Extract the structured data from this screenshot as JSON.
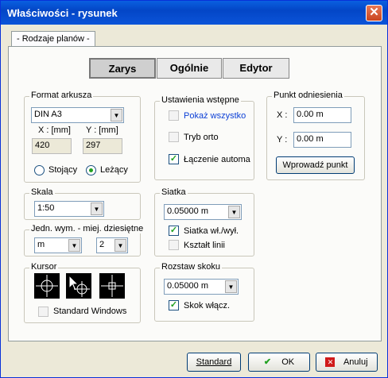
{
  "window": {
    "title": "Właściwości - rysunek",
    "close_glyph": "✕"
  },
  "tab": {
    "label": "- Rodzaje planów -"
  },
  "mode_buttons": [
    "Zarys",
    "Ogólnie",
    "Edytor"
  ],
  "format": {
    "label": "Format arkusza",
    "sheet_value": "DIN A3",
    "x_label": "X : [mm]",
    "y_label": "Y : [mm]",
    "x_value": "420",
    "y_value": "297",
    "portrait_label": "Stojący",
    "landscape_label": "Leżący",
    "orientation_selected": "Leżący"
  },
  "scale": {
    "label": "Skala",
    "value": "1:50"
  },
  "units": {
    "label": "Jedn. wym. - miej. dziesiętne",
    "unit_value": "m",
    "decimals_value": "2"
  },
  "cursor": {
    "label": "Kursor",
    "options": [
      "crosshair-circle-icon",
      "arrow-crosshair-icon",
      "crosshair-icon"
    ],
    "standard_windows_label": "Standard Windows",
    "standard_windows_checked": false
  },
  "presets": {
    "label": "Ustawienia wstępne",
    "show_all_label": "Pokaż wszystko",
    "show_all_checked": false,
    "ortho_label": "Tryb orto",
    "ortho_checked": false,
    "connect_label": "Łączenie automa",
    "connect_checked": true
  },
  "grid": {
    "label": "Siatka",
    "value": "0.05000 m",
    "grid_on_label": "Siatka wł./wył.",
    "grid_on_checked": true,
    "lines_label": "Kształt linii",
    "lines_checked": false
  },
  "snap": {
    "label": "Rozstaw skoku",
    "value": "0.05000 m",
    "snap_on_label": "Skok włącz.",
    "snap_on_checked": true
  },
  "reference": {
    "label": "Punkt odniesienia",
    "x_label": "X :",
    "y_label": "Y :",
    "x_value": "0.00 m",
    "y_value": "0.00 m",
    "enter_button": "Wprowadź punkt"
  },
  "footer": {
    "standard": "Standard",
    "ok": "OK",
    "cancel": "Anuluj"
  },
  "colors": {
    "link_blue": "#0b3fd6",
    "check_green": "#21a121",
    "cancel_red": "#d01a1a"
  }
}
